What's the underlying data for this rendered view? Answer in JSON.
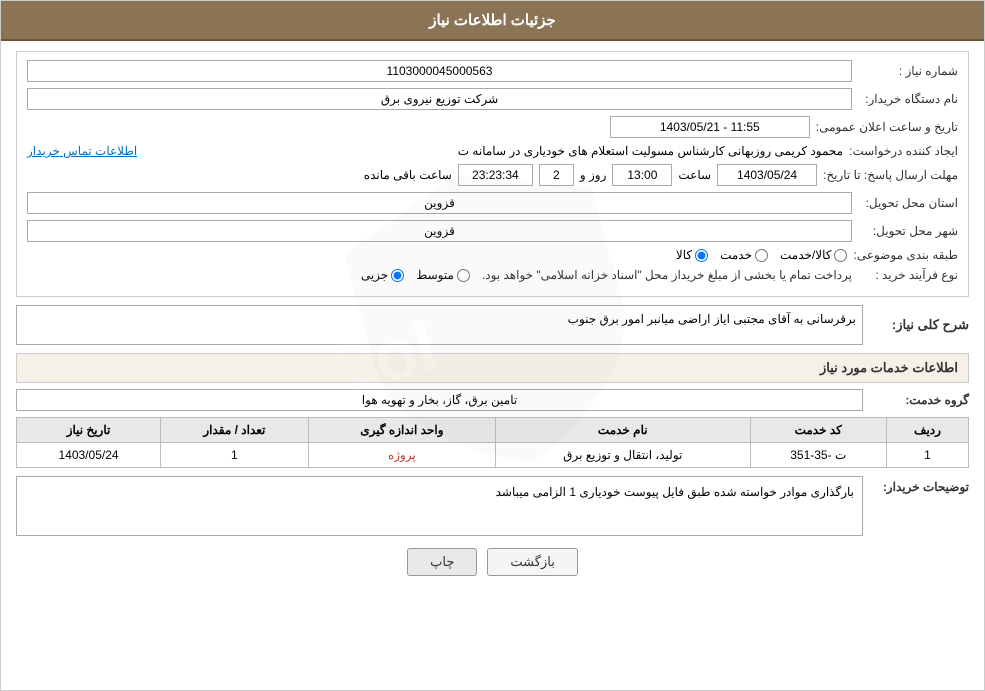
{
  "header": {
    "title": "جزئیات اطلاعات نیاز"
  },
  "fields": {
    "order_number_label": "شماره نیاز :",
    "order_number_value": "1103000045000563",
    "requester_label": "نام دستگاه خریدار:",
    "requester_value": "شرکت توزیع نیروی برق",
    "creator_label": "ایجاد کننده درخواست:",
    "creator_value": "محمود کریمی روزبهانی کارشناس  مسولیت استعلام های خودیاری در سامانه ت",
    "creator_link": "اطلاعات تماس خریدار",
    "response_deadline_label": "مهلت ارسال پاسخ: تا تاریخ:",
    "date_value": "1403/05/24",
    "time_label": "ساعت",
    "time_value": "13:00",
    "days_label": "روز و",
    "days_value": "2",
    "remaining_label": "ساعت باقی مانده",
    "remaining_value": "23:23:34",
    "province_label": "استان محل تحویل:",
    "province_value": "قزوین",
    "city_label": "شهر محل تحویل:",
    "city_value": "قزوین",
    "category_label": "طبقه بندی موضوعی:",
    "category_options": [
      "کالا",
      "خدمت",
      "کالا/خدمت"
    ],
    "category_selected": "کالا",
    "process_label": "نوع فرآیند خرید :",
    "process_options": [
      "جزیی",
      "متوسط"
    ],
    "process_note": "پرداخت تمام یا بخشی از مبلغ خریداز محل \"اسناد خزانه اسلامی\" خواهد بود.",
    "description_label": "شرح کلی نیاز:",
    "description_value": "برقرسانی به آقای مجتبی ایاز اراضی میانبر امور برق جنوب"
  },
  "services_section": {
    "title": "اطلاعات خدمات مورد نیاز",
    "group_label": "گروه خدمت:",
    "group_value": "تامین برق، گاز، بخار و تهویه هوا",
    "table": {
      "headers": [
        "ردیف",
        "کد خدمت",
        "نام خدمت",
        "واحد اندازه گیری",
        "تعداد / مقدار",
        "تاریخ نیاز"
      ],
      "rows": [
        {
          "row": "1",
          "code": "ت -35-351",
          "name": "تولید، انتقال و توزیع برق",
          "unit": "پروژه",
          "qty": "1",
          "date": "1403/05/24"
        }
      ]
    }
  },
  "buyer_desc_label": "توضیحات خریدار:",
  "buyer_desc_value": "بارگذاری موادر خواسته شده طبق فایل پیوست خودیاری 1 الزامی میباشد",
  "buttons": {
    "print": "چاپ",
    "back": "بازگشت"
  }
}
